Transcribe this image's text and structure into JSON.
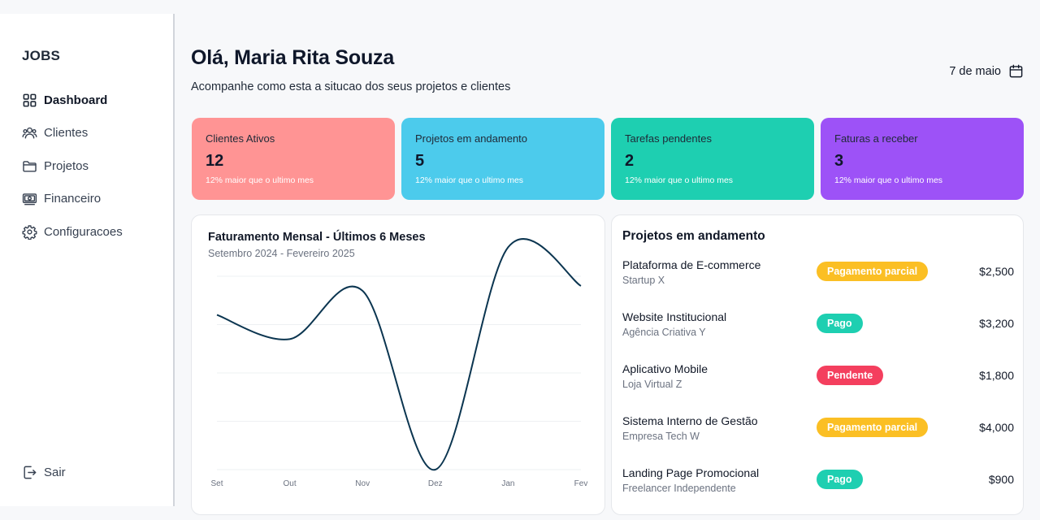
{
  "sidebar": {
    "brand": "JOBS",
    "items": [
      {
        "label": "Dashboard",
        "icon": "grid-icon",
        "active": true
      },
      {
        "label": "Clientes",
        "icon": "users-icon",
        "active": false
      },
      {
        "label": "Projetos",
        "icon": "folder-icon",
        "active": false
      },
      {
        "label": "Financeiro",
        "icon": "banknote-icon",
        "active": false
      },
      {
        "label": "Configuracoes",
        "icon": "gear-icon",
        "active": false
      }
    ],
    "logout_label": "Sair"
  },
  "header": {
    "greeting": "Olá, Maria Rita Souza",
    "subtitle": "Acompanhe como esta a situcao dos seus projetos e clientes",
    "date": "7 de maio"
  },
  "stats": [
    {
      "title": "Clientes Ativos",
      "value": "12",
      "note": "12% maior que o ultimo mes",
      "color": "#ff9494"
    },
    {
      "title": "Projetos em andamento",
      "value": "5",
      "note": "12% maior que o ultimo mes",
      "color": "#4ccbec"
    },
    {
      "title": "Tarefas pendentes",
      "value": "2",
      "note": "12% maior que o ultimo mes",
      "color": "#1ecfb1"
    },
    {
      "title": "Faturas a receber",
      "value": "3",
      "note": "12% maior que o ultimo mes",
      "color": "#9d52f7"
    }
  ],
  "revenue": {
    "title": "Faturamento Mensal - Últimos 6 Meses",
    "subtitle": "Setembro 2024 - Fevereiro 2025"
  },
  "chart_data": {
    "type": "line",
    "title": "Faturamento Mensal - Últimos 6 Meses",
    "subtitle": "Setembro 2024 - Fevereiro 2025",
    "categories": [
      "Set",
      "Out",
      "Nov",
      "Dez",
      "Jan",
      "Fev"
    ],
    "values": [
      3.2,
      2.7,
      3.7,
      0,
      4.6,
      3.8
    ],
    "ylim": [
      0,
      4
    ],
    "grid": true,
    "line_color": "#0b3550"
  },
  "projects": {
    "title": "Projetos em andamento",
    "rows": [
      {
        "name": "Plataforma de E-commerce",
        "client": "Startup X",
        "status": "Pagamento parcial",
        "status_color": "#fbbf24",
        "amount": "$2,500"
      },
      {
        "name": "Website Institucional",
        "client": "Agência Criativa Y",
        "status": "Pago",
        "status_color": "#1ecfb1",
        "amount": "$3,200"
      },
      {
        "name": "Aplicativo Mobile",
        "client": "Loja Virtual Z",
        "status": "Pendente",
        "status_color": "#f43f5e",
        "amount": "$1,800"
      },
      {
        "name": "Sistema Interno de Gestão",
        "client": "Empresa Tech W",
        "status": "Pagamento parcial",
        "status_color": "#fbbf24",
        "amount": "$4,000"
      },
      {
        "name": "Landing Page Promocional",
        "client": "Freelancer Independente",
        "status": "Pago",
        "status_color": "#1ecfb1",
        "amount": "$900"
      }
    ]
  }
}
